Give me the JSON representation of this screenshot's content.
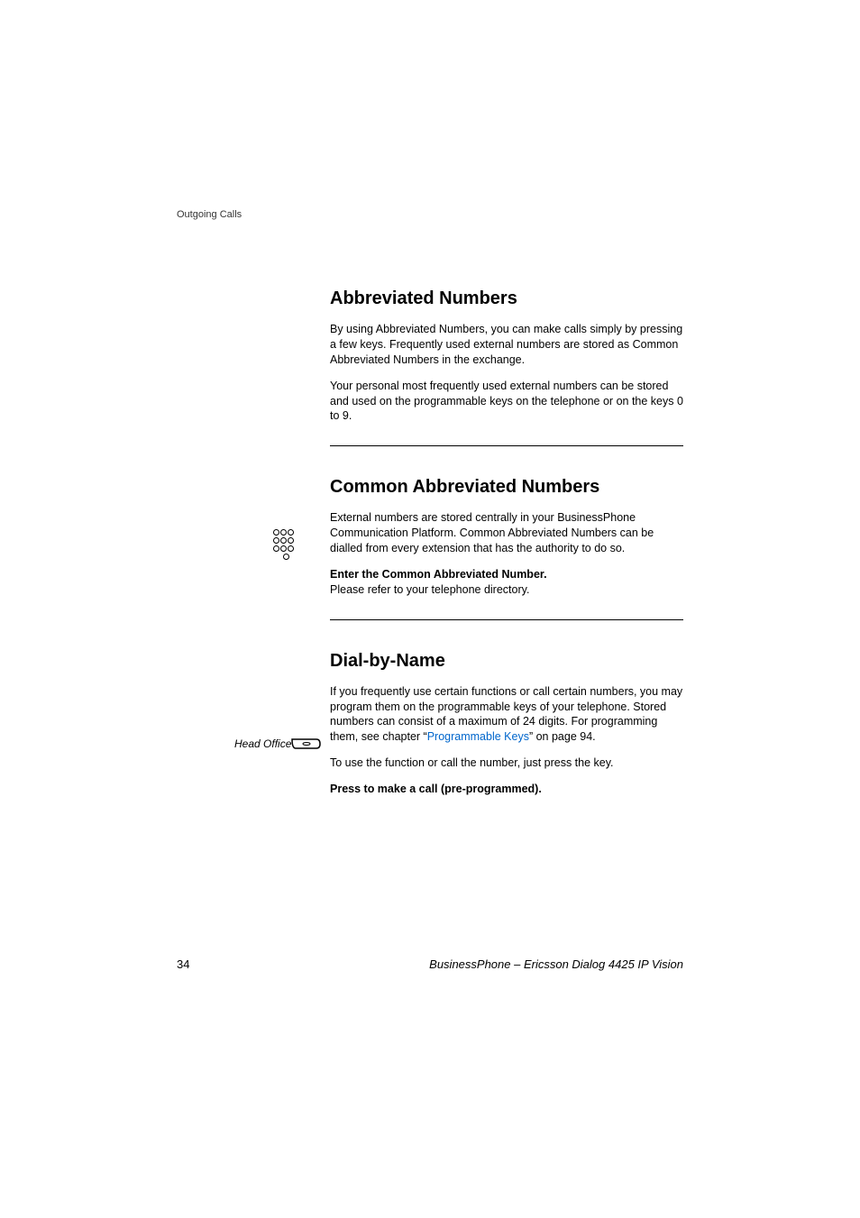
{
  "header": {
    "section_name": "Outgoing Calls"
  },
  "sections": {
    "abbrev_numbers": {
      "heading": "Abbreviated Numbers",
      "para1": "By using Abbreviated Numbers, you can make calls simply by pressing a few keys. Frequently used external numbers are stored as Common Abbreviated Numbers in the exchange.",
      "para2": "Your personal most frequently used external numbers can be stored and used on the programmable keys on the telephone or on the keys 0 to 9."
    },
    "common_abbrev": {
      "heading": "Common Abbreviated Numbers",
      "para1": "External numbers are stored centrally in your BusinessPhone Communication Platform. Common Abbreviated Numbers can be dialled from every extension that has the authority to do so.",
      "step_bold": "Enter the Common Abbreviated Number.",
      "step_text": "Please refer to your telephone directory."
    },
    "dial_by_name": {
      "heading": "Dial-by-Name",
      "para1_pre": "If you frequently use certain functions or call certain numbers, you may program them on the programmable keys of your telephone. Stored numbers can consist of a maximum of 24 digits. For programming them, see chapter “",
      "para1_link": "Programmable Keys",
      "para1_post": "” on page 94.",
      "para2": "To use the function or call the number, just press the key.",
      "step_bold": "Press to make a call (pre-programmed).",
      "key_label": "Head Office"
    }
  },
  "footer": {
    "page_number": "34",
    "doc_title": "BusinessPhone – Ericsson Dialog 4425 IP Vision"
  }
}
